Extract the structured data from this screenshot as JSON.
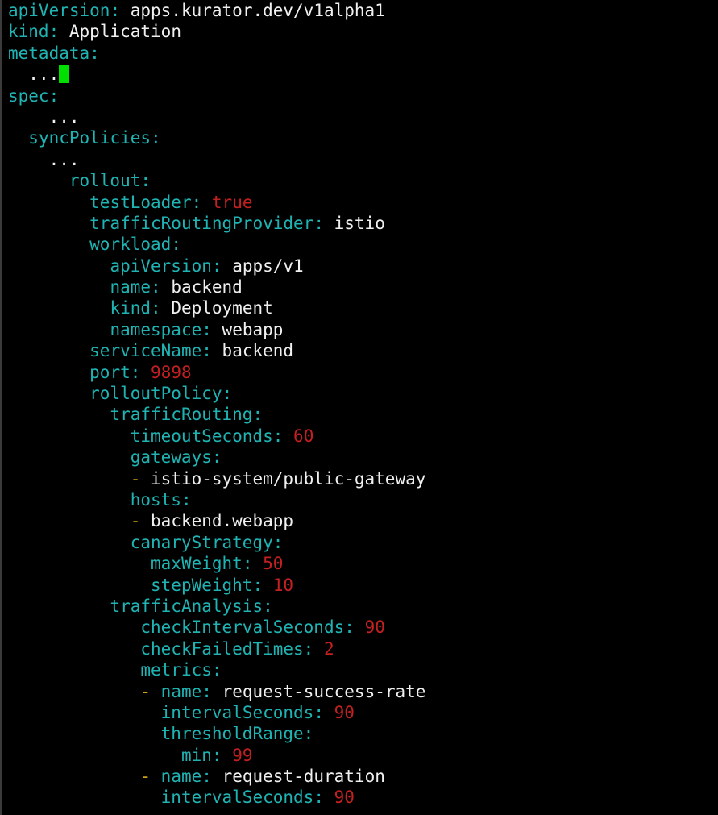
{
  "colors": {
    "background": "#000000",
    "key": "#1fb3b3",
    "value_text": "#f0f0f0",
    "value_number": "#c42020",
    "list_dash": "#d4a217",
    "cursor": "#00e000"
  },
  "editor": {
    "lines": [
      {
        "indent": 0,
        "key": "apiVersion",
        "value": "apps.kurator.dev/v1alpha1",
        "type": "str"
      },
      {
        "indent": 0,
        "key": "kind",
        "value": "Application",
        "type": "str"
      },
      {
        "indent": 0,
        "key": "metadata",
        "value": "",
        "type": "none"
      },
      {
        "indent": 2,
        "text": "...",
        "cursor": true
      },
      {
        "indent": 0,
        "key": "spec",
        "value": "",
        "type": "none"
      },
      {
        "indent": 4,
        "text": "..."
      },
      {
        "indent": 2,
        "key": "syncPolicies",
        "value": "",
        "type": "none"
      },
      {
        "indent": 4,
        "text": "..."
      },
      {
        "indent": 6,
        "key": "rollout",
        "value": "",
        "type": "none"
      },
      {
        "indent": 8,
        "key": "testLoader",
        "value": "true",
        "type": "bool"
      },
      {
        "indent": 8,
        "key": "trafficRoutingProvider",
        "value": "istio",
        "type": "str"
      },
      {
        "indent": 8,
        "key": "workload",
        "value": "",
        "type": "none"
      },
      {
        "indent": 10,
        "key": "apiVersion",
        "value": "apps/v1",
        "type": "str"
      },
      {
        "indent": 10,
        "key": "name",
        "value": "backend",
        "type": "str"
      },
      {
        "indent": 10,
        "key": "kind",
        "value": "Deployment",
        "type": "str"
      },
      {
        "indent": 10,
        "key": "namespace",
        "value": "webapp",
        "type": "str"
      },
      {
        "indent": 8,
        "key": "serviceName",
        "value": "backend",
        "type": "str"
      },
      {
        "indent": 8,
        "key": "port",
        "value": "9898",
        "type": "num"
      },
      {
        "indent": 8,
        "key": "rolloutPolicy",
        "value": "",
        "type": "none"
      },
      {
        "indent": 10,
        "key": "trafficRouting",
        "value": "",
        "type": "none"
      },
      {
        "indent": 12,
        "key": "timeoutSeconds",
        "value": "60",
        "type": "num"
      },
      {
        "indent": 12,
        "key": "gateways",
        "value": "",
        "type": "none"
      },
      {
        "indent": 12,
        "dash": true,
        "value": "istio-system/public-gateway",
        "type": "str"
      },
      {
        "indent": 12,
        "key": "hosts",
        "value": "",
        "type": "none"
      },
      {
        "indent": 12,
        "dash": true,
        "value": "backend.webapp",
        "type": "str"
      },
      {
        "indent": 12,
        "key": "canaryStrategy",
        "value": "",
        "type": "none"
      },
      {
        "indent": 14,
        "key": "maxWeight",
        "value": "50",
        "type": "num"
      },
      {
        "indent": 14,
        "key": "stepWeight",
        "value": "10",
        "type": "num"
      },
      {
        "indent": 10,
        "key": "trafficAnalysis",
        "value": "",
        "type": "none"
      },
      {
        "indent": 13,
        "key": "checkIntervalSeconds",
        "value": "90",
        "type": "num"
      },
      {
        "indent": 13,
        "key": "checkFailedTimes",
        "value": "2",
        "type": "num"
      },
      {
        "indent": 13,
        "key": "metrics",
        "value": "",
        "type": "none"
      },
      {
        "indent": 13,
        "dash": true,
        "key": "name",
        "value": "request-success-rate",
        "type": "str"
      },
      {
        "indent": 15,
        "key": "intervalSeconds",
        "value": "90",
        "type": "num"
      },
      {
        "indent": 15,
        "key": "thresholdRange",
        "value": "",
        "type": "none"
      },
      {
        "indent": 17,
        "key": "min",
        "value": "99",
        "type": "num"
      },
      {
        "indent": 13,
        "dash": true,
        "key": "name",
        "value": "request-duration",
        "type": "str"
      },
      {
        "indent": 15,
        "key": "intervalSeconds",
        "value": "90",
        "type": "num"
      }
    ]
  }
}
